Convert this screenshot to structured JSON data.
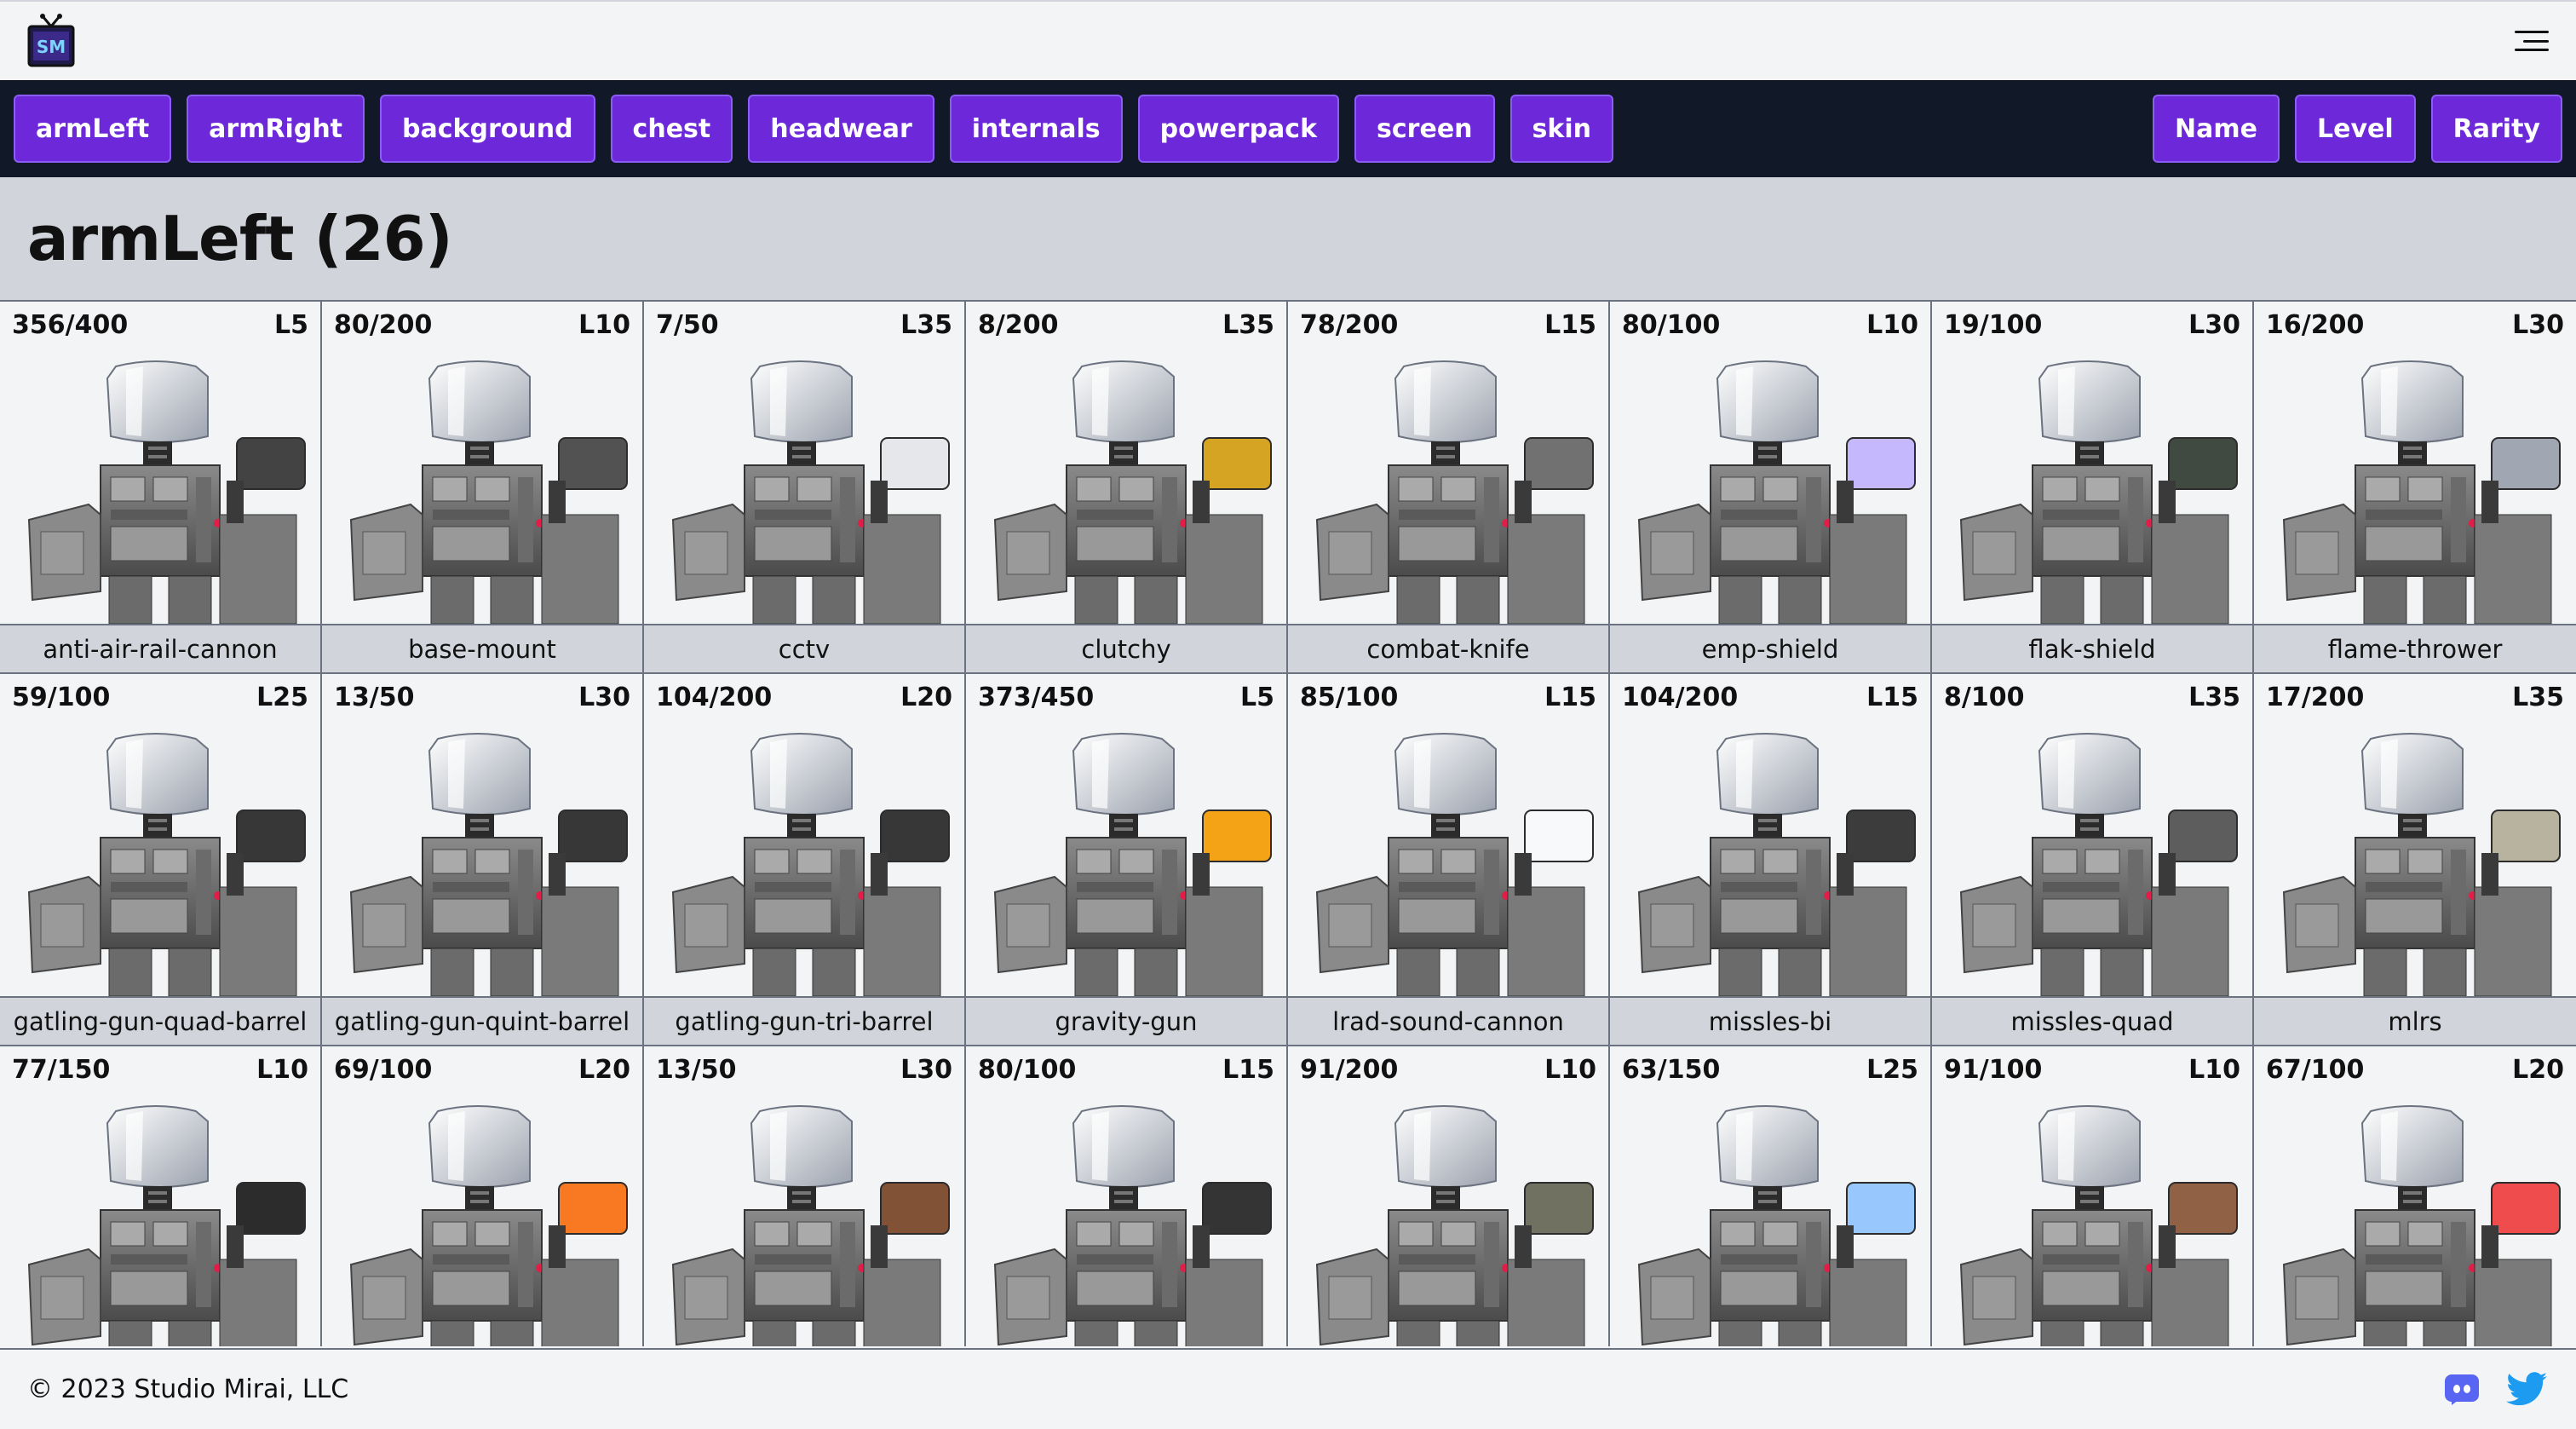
{
  "header": {
    "logo_text": "SM",
    "logo_icon": "tv-logo-icon",
    "menu_icon": "hamburger-menu-icon"
  },
  "categories": [
    "armLeft",
    "armRight",
    "background",
    "chest",
    "headwear",
    "internals",
    "powerpack",
    "screen",
    "skin"
  ],
  "sort_buttons": [
    "Name",
    "Level",
    "Rarity"
  ],
  "page_title": "armLeft (26)",
  "items": [
    {
      "count": "356/400",
      "level": "L5",
      "name": "anti-air-rail-cannon",
      "accent": "#3a3a3a"
    },
    {
      "count": "80/200",
      "level": "L10",
      "name": "base-mount",
      "accent": "#4a4a4a"
    },
    {
      "count": "7/50",
      "level": "L35",
      "name": "cctv",
      "accent": "#e5e7eb"
    },
    {
      "count": "8/200",
      "level": "L35",
      "name": "clutchy",
      "accent": "#d4a017"
    },
    {
      "count": "78/200",
      "level": "L15",
      "name": "combat-knife",
      "accent": "#6b6b6b"
    },
    {
      "count": "80/100",
      "level": "L10",
      "name": "emp-shield",
      "accent": "#c4b5fd"
    },
    {
      "count": "19/100",
      "level": "L30",
      "name": "flak-shield",
      "accent": "#374137"
    },
    {
      "count": "16/200",
      "level": "L30",
      "name": "flame-thrower",
      "accent": "#9ca3af"
    },
    {
      "count": "59/100",
      "level": "L25",
      "name": "gatling-gun-quad-barrel",
      "accent": "#2d2d2d"
    },
    {
      "count": "13/50",
      "level": "L30",
      "name": "gatling-gun-quint-barrel",
      "accent": "#2d2d2d"
    },
    {
      "count": "104/200",
      "level": "L20",
      "name": "gatling-gun-tri-barrel",
      "accent": "#2d2d2d"
    },
    {
      "count": "373/450",
      "level": "L5",
      "name": "gravity-gun",
      "accent": "#f59e0b"
    },
    {
      "count": "85/100",
      "level": "L15",
      "name": "lrad-sound-cannon",
      "accent": "#f9fafb"
    },
    {
      "count": "104/200",
      "level": "L15",
      "name": "missles-bi",
      "accent": "#333333"
    },
    {
      "count": "8/100",
      "level": "L35",
      "name": "missles-quad",
      "accent": "#555555"
    },
    {
      "count": "17/200",
      "level": "L35",
      "name": "mlrs",
      "accent": "#b5b09a"
    },
    {
      "count": "77/150",
      "level": "L10",
      "name": "",
      "accent": "#222222"
    },
    {
      "count": "69/100",
      "level": "L20",
      "name": "",
      "accent": "#f97316"
    },
    {
      "count": "13/50",
      "level": "L30",
      "name": "",
      "accent": "#7c4a2d"
    },
    {
      "count": "80/100",
      "level": "L15",
      "name": "",
      "accent": "#2a2a2a"
    },
    {
      "count": "91/200",
      "level": "L10",
      "name": "",
      "accent": "#6b6b5a"
    },
    {
      "count": "63/150",
      "level": "L25",
      "name": "",
      "accent": "#93c5fd"
    },
    {
      "count": "91/100",
      "level": "L10",
      "name": "",
      "accent": "#8b5a3c"
    },
    {
      "count": "67/100",
      "level": "L20",
      "name": "",
      "accent": "#ef4444"
    }
  ],
  "footer": {
    "copyright": "© 2023 Studio Mirai, LLC",
    "discord_icon": "discord-icon",
    "twitter_icon": "twitter-icon",
    "discord_color": "#5865F2",
    "twitter_color": "#1D9BF0"
  },
  "colors": {
    "accent": "#6d28d9",
    "nav_bg": "#111827",
    "band_bg": "#d1d5db"
  }
}
